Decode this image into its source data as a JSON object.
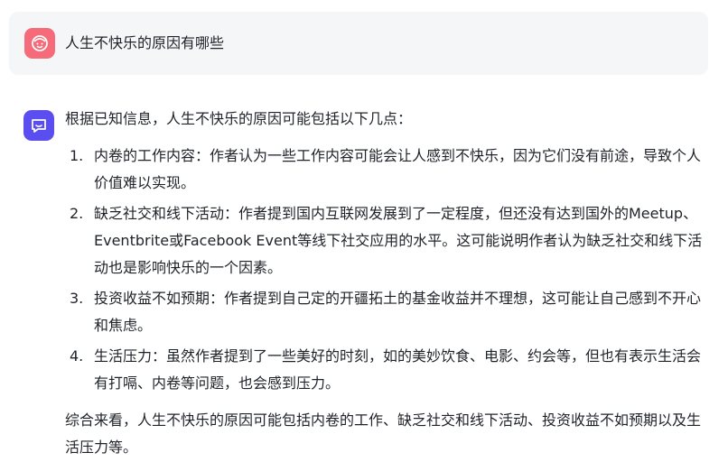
{
  "user": {
    "question": "人生不快乐的原因有哪些"
  },
  "assistant": {
    "intro": "根据已知信息，人生不快乐的原因可能包括以下几点：",
    "points": [
      {
        "num": "1.",
        "text": "内卷的工作内容：作者认为一些工作内容可能会让人感到不快乐，因为它们没有前途，导致个人价值难以实现。"
      },
      {
        "num": "2.",
        "text": "缺乏社交和线下活动：作者提到国内互联网发展到了一定程度，但还没有达到国外的Meetup、Eventbrite或Facebook Event等线下社交应用的水平。这可能说明作者认为缺乏社交和线下活动也是影响快乐的一个因素。"
      },
      {
        "num": "3.",
        "text": "投资收益不如预期：作者提到自己定的开疆拓土的基金收益并不理想，这可能让自己感到不开心和焦虑。"
      },
      {
        "num": "4.",
        "text": "生活压力：虽然作者提到了一些美好的时刻，如的美妙饮食、电影、约会等，但也有表示生活会有打嗝、内卷等问题，也会感到压力。"
      }
    ],
    "summary": "综合来看，人生不快乐的原因可能包括内卷的工作、缺乏社交和线下活动、投资收益不如预期以及生活压力等。"
  },
  "icons": {
    "user_avatar": "smiley-face-icon",
    "assistant_avatar": "chat-bubble-icon"
  },
  "colors": {
    "user_avatar_bg": "#f56b7a",
    "assistant_avatar_bg": "#5b4ef0",
    "user_bubble_bg": "#f5f6f8",
    "text": "#1f2329"
  }
}
